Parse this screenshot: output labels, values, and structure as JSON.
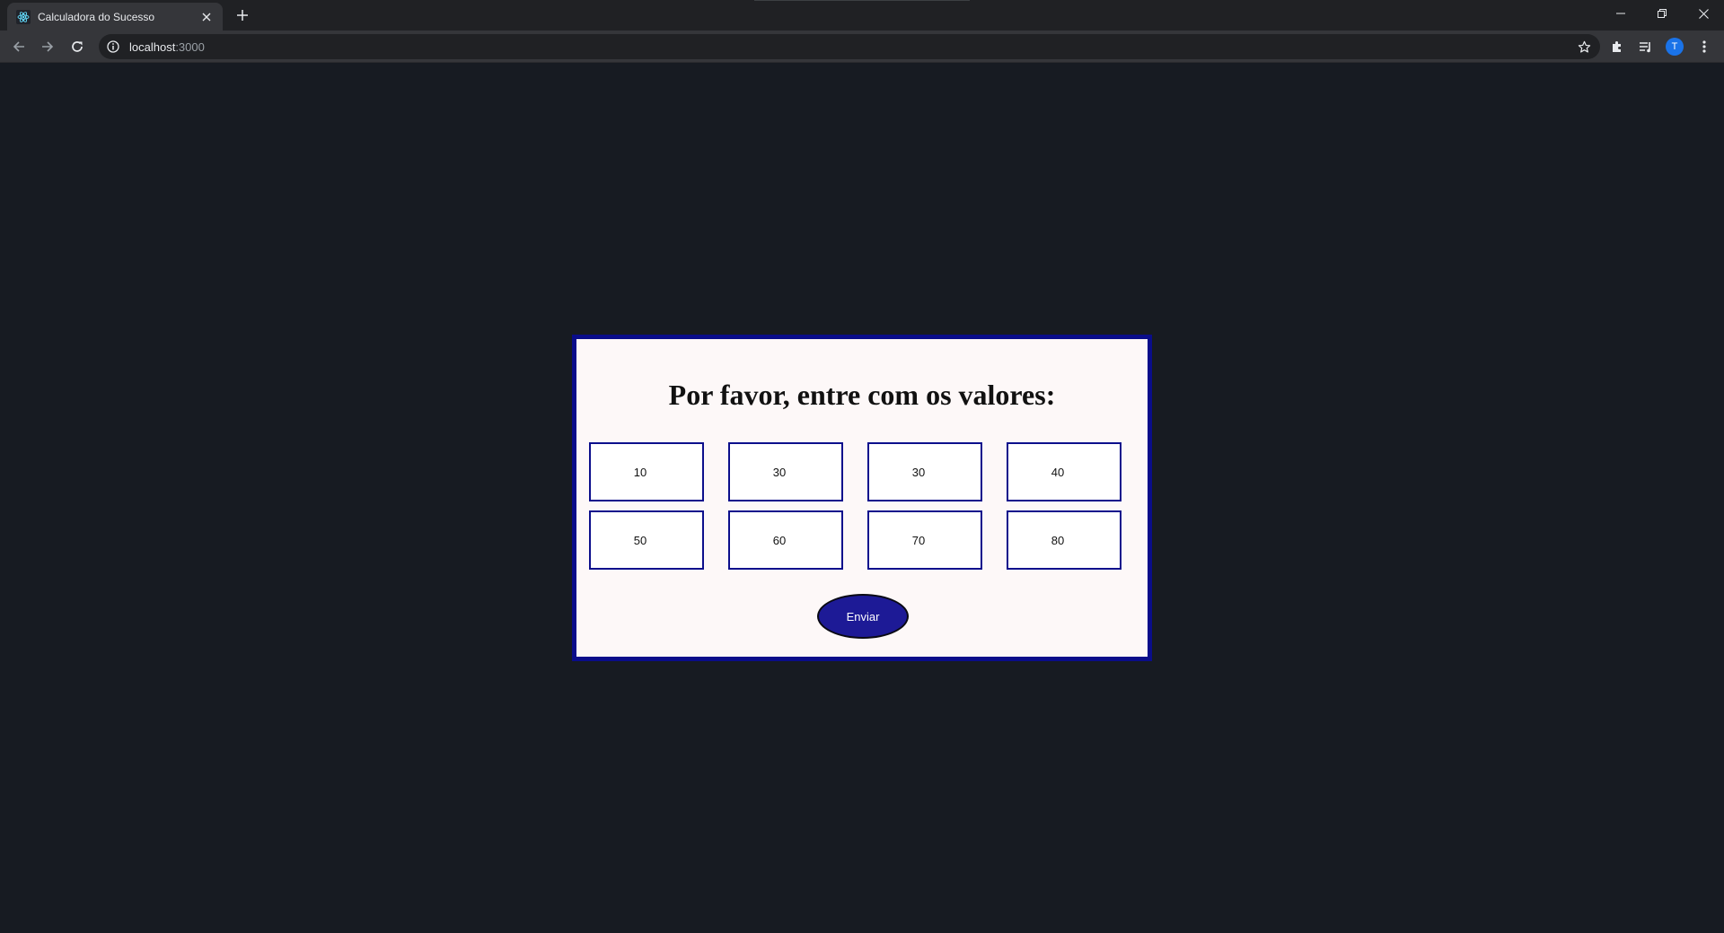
{
  "browser": {
    "tab_title": "Calculadora do Sucesso",
    "url_host": "localhost",
    "url_port": ":3000",
    "profile_initial": "T"
  },
  "page": {
    "heading": "Por favor, entre com os valores:",
    "inputs": [
      "10",
      "30",
      "30",
      "40",
      "50",
      "60",
      "70",
      "80"
    ],
    "submit_label": "Enviar"
  },
  "colors": {
    "page_background": "#171b22",
    "card_background": "#fdf8f8",
    "card_border": "#0a0d8a",
    "button_fill": "#1d1a96"
  }
}
